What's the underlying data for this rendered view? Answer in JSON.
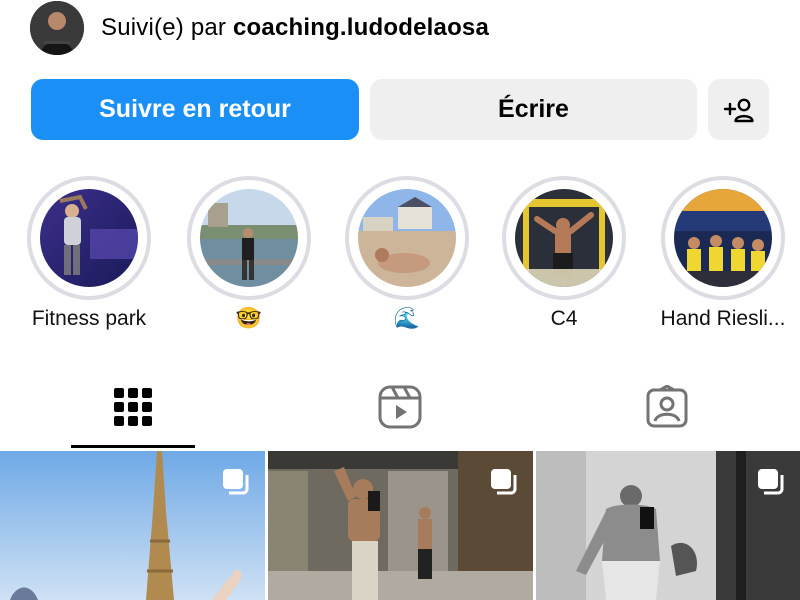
{
  "profile": {
    "followed_prefix": "Suivi(e) par",
    "followed_by": "coaching.ludodelaosa"
  },
  "actions": {
    "follow_back": "Suivre en retour",
    "message": "Écrire"
  },
  "highlights": [
    {
      "label": "Fitness park"
    },
    {
      "label": "🤓"
    },
    {
      "label": "🌊"
    },
    {
      "label": "C4"
    },
    {
      "label": "Hand Riesli..."
    }
  ],
  "tabs": [
    {
      "icon": "grid-icon",
      "active": true
    },
    {
      "icon": "reels-icon",
      "active": false
    },
    {
      "icon": "tagged-icon",
      "active": false
    }
  ],
  "posts": [
    {
      "multi": true
    },
    {
      "multi": true
    },
    {
      "multi": true
    }
  ],
  "colors": {
    "primary": "#1a8ff5",
    "secondary_button": "#efefef",
    "ring": "#dcdde2"
  }
}
